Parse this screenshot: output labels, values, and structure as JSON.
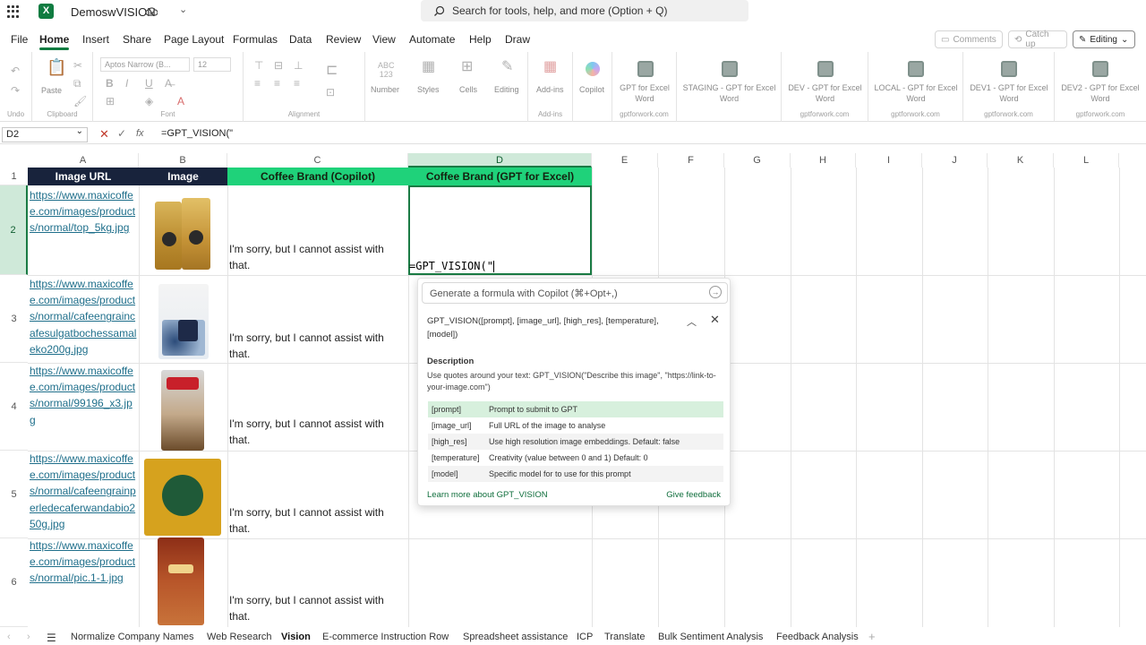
{
  "title_bar": {
    "app_name": "DemoswVISION",
    "search_placeholder": "Search for tools, help, and more (Option + Q)"
  },
  "menu": [
    "File",
    "Home",
    "Insert",
    "Share",
    "Page Layout",
    "Formulas",
    "Data",
    "Review",
    "View",
    "Automate",
    "Help",
    "Draw"
  ],
  "menu_active": "Home",
  "right_buttons": {
    "comments": "Comments",
    "catch_up": "Catch up",
    "editing": "Editing"
  },
  "ribbon": {
    "undo": "Undo",
    "paste": "Paste",
    "clipboard": "Clipboard",
    "font_name": "Aptos Narrow (B...",
    "font_size": "12",
    "font": "Font",
    "alignment": "Alignment",
    "number": "Number",
    "styles": "Styles",
    "cells": "Cells",
    "editing": "Editing",
    "add_ins": "Add-ins",
    "add_ins_group": "Add-ins",
    "copilot": "Copilot",
    "gpt_buttons": [
      {
        "label": "GPT for Excel Word",
        "group": "gptforwork.com"
      },
      {
        "label": "STAGING - GPT for Excel Word",
        "group": ""
      },
      {
        "label": "DEV - GPT for Excel Word",
        "group": "gptforwork.com"
      },
      {
        "label": "LOCAL - GPT for Excel Word",
        "group": "gptforwork.com"
      },
      {
        "label": "DEV1 - GPT for Excel Word",
        "group": "gptforwork.com"
      },
      {
        "label": "DEV2 - GPT for Excel Word",
        "group": "gptforwork.com"
      }
    ]
  },
  "formula_bar": {
    "name_box": "D2",
    "formula": "=GPT_VISION(\""
  },
  "columns": [
    "A",
    "B",
    "C",
    "D",
    "E",
    "F",
    "G",
    "H",
    "I",
    "J",
    "K",
    "L"
  ],
  "rows": [
    "1",
    "2",
    "3",
    "4",
    "5",
    "6"
  ],
  "headers": {
    "a": "Image URL",
    "b": "Image",
    "c": "Coffee Brand (Copilot)",
    "d": "Coffee Brand (GPT for Excel)"
  },
  "data_rows": [
    {
      "url": "https://www.maxicoffee.com/images/products/normal/top_5kg.jpg",
      "answer": "I'm sorry, but I cannot assist with that."
    },
    {
      "url": "https://www.maxicoffee.com/images/products/normal/cafeengraincafesulgatbochessamaleko200g.jpg",
      "answer": "I'm sorry, but I cannot assist with that."
    },
    {
      "url": "https://www.maxicoffee.com/images/products/normal/99196_x3.jpg",
      "answer": "I'm sorry, but I cannot assist with that."
    },
    {
      "url": "https://www.maxicoffee.com/images/products/normal/cafeengrainperledecaferwandabio250g.jpg",
      "answer": "I'm sorry, but I cannot assist with that."
    },
    {
      "url": "https://www.maxicoffee.com/images/products/normal/pic.1-1.jpg",
      "answer": "I'm sorry, but I cannot assist with that."
    }
  ],
  "active_cell_text": "=GPT_VISION(\"",
  "popup": {
    "copilot_placeholder": "Generate a formula with Copilot (⌘+Opt+,)",
    "signature": "GPT_VISION([prompt], [image_url], [high_res], [temperature], [model])",
    "description_heading": "Description",
    "description": "Use quotes around your text: GPT_VISION(\"Describe this image\", \"https://link-to-your-image.com\")",
    "params": [
      {
        "name": "[prompt]",
        "desc": "Prompt to submit to GPT"
      },
      {
        "name": "[image_url]",
        "desc": "Full URL of the image to analyse"
      },
      {
        "name": "[high_res]",
        "desc": "Use high resolution image embeddings. Default: false"
      },
      {
        "name": "[temperature]",
        "desc": "Creativity (value between 0 and 1) Default: 0"
      },
      {
        "name": "[model]",
        "desc": "Specific model for to use for this prompt"
      }
    ],
    "learn_more": "Learn more about GPT_VISION",
    "feedback": "Give feedback"
  },
  "sheet_tabs": [
    "Normalize Company Names",
    "Web Research",
    "Vision",
    "E-commerce Instruction Row",
    "Spreadsheet assistance",
    "ICP",
    "Translate",
    "Bulk Sentiment Analysis",
    "Feedback Analysis"
  ],
  "active_tab": "Vision",
  "colors": {
    "excel_green": "#107c41",
    "header_dark": "#18233c",
    "header_green": "#1fd27a",
    "link": "#1f6f8b"
  }
}
